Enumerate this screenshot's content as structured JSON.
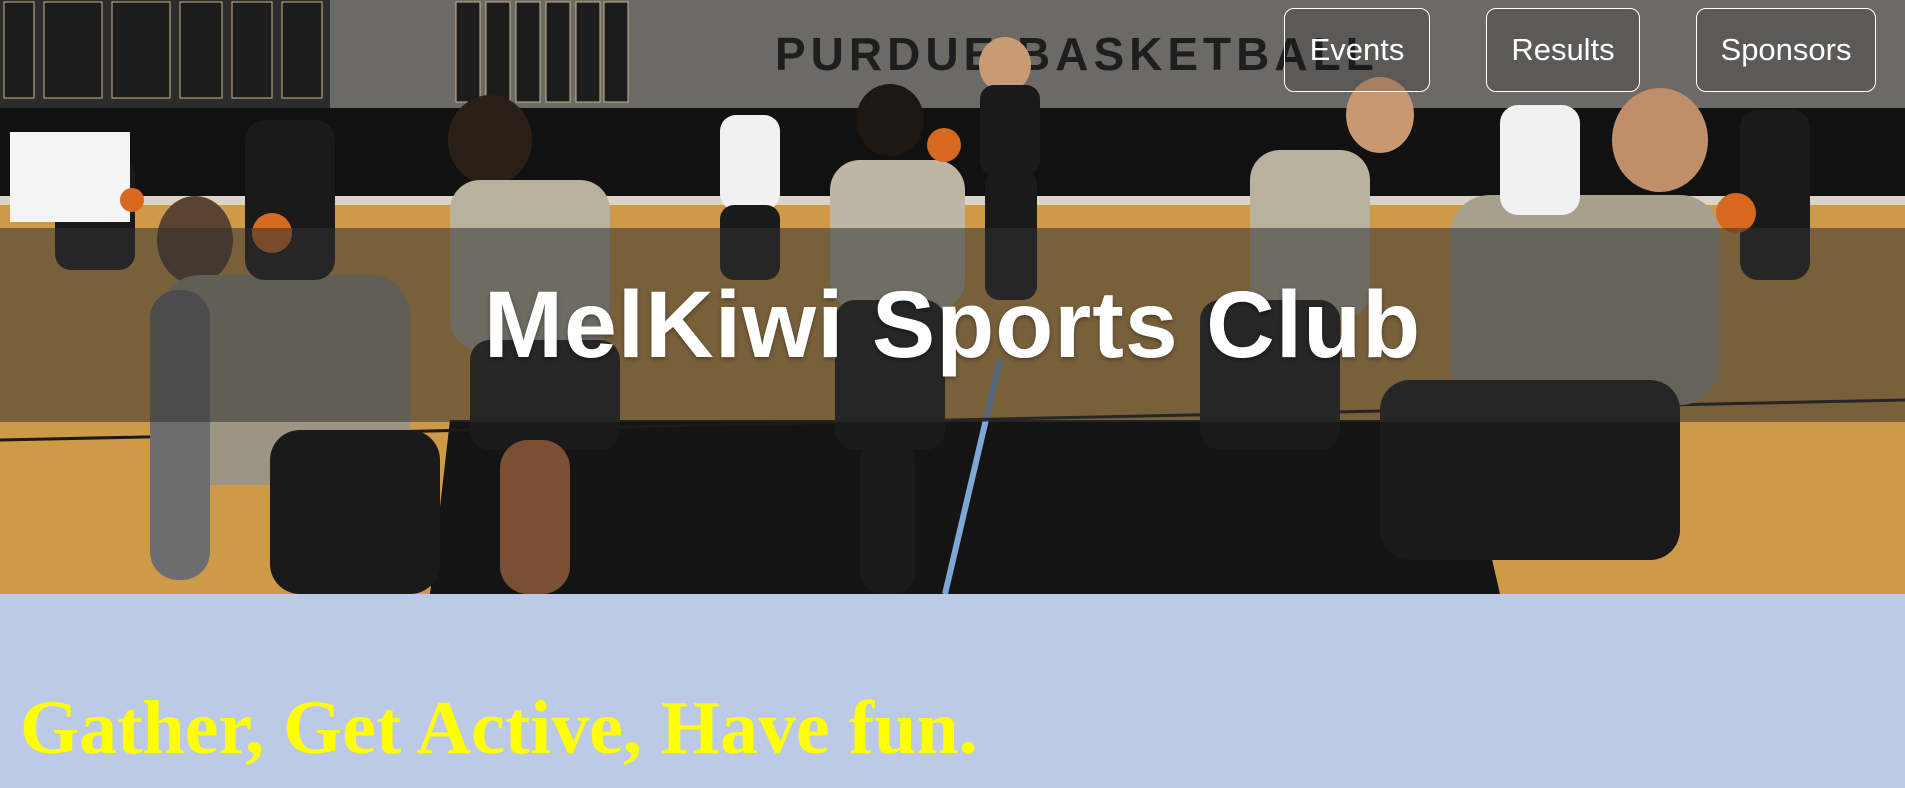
{
  "hero": {
    "title": "MelKiwi Sports Club",
    "image_alt": "basketball practice",
    "wall_text": "PURDUE BASKETBALL"
  },
  "nav": {
    "events_label": "Events",
    "results_label": "Results",
    "sponsors_label": "Sponsors"
  },
  "tagline": "Gather, Get Active, Have fun.",
  "colors": {
    "page_background": "#bccae8",
    "tagline": "#ffff00",
    "title": "#ffffff"
  }
}
